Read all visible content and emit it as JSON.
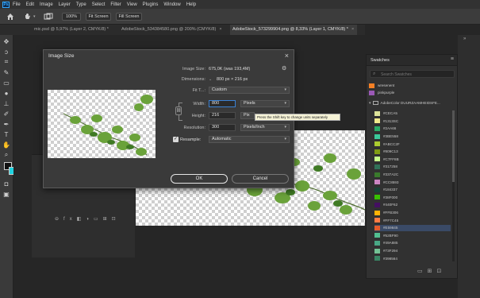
{
  "menubar": {
    "logo": "Ps",
    "items": [
      "File",
      "Edit",
      "Image",
      "Layer",
      "Type",
      "Select",
      "Filter",
      "View",
      "Plugins",
      "Window",
      "Help"
    ]
  },
  "options": {
    "zoom": "100%",
    "fit_screen": "Fit Screen",
    "fill_screen": "Fill Screen"
  },
  "tabs": [
    {
      "label": "mic.psd @ 5,97% (Layer 2, CMYK/8) *",
      "close": "×"
    },
    {
      "label": "AdobeStock_534384580.png @ 200% (CMYK/8)",
      "close": "×"
    },
    {
      "label": "AdobeStock_573299904.png @ 8,33% (Layer 1, CMYK/8) *",
      "close": "×"
    }
  ],
  "dialog": {
    "title": "Image Size",
    "close": "×",
    "image_size_label": "Image Size:",
    "image_size_value": "675,0K (was 193,4M)",
    "gear": "⚙",
    "dimensions_label": "Dimensions:",
    "dimensions_value": "800 px  ×  216 px",
    "fit_to_label": "Fit T...:",
    "fit_to_value": "Custom",
    "width_label": "Width:",
    "width_value": "800",
    "width_unit": "Pixels",
    "height_label": "Height:",
    "height_value": "216",
    "height_unit": "Pix",
    "resolution_label": "Resolution:",
    "resolution_value": "300",
    "resolution_unit": "Pixels/Inch",
    "resample_label": "Resample:",
    "resample_value": "Automatic",
    "tooltip": "Press the Shift key to change units separately",
    "ok": "OK",
    "cancel": "Cancel"
  },
  "swatches": {
    "title": "Swatches",
    "search_placeholder": "Search Swatches",
    "top_items": [
      {
        "name": "wresenent",
        "color": "#f58025"
      },
      {
        "name": "pinkpurple",
        "color": "#9b59b6"
      }
    ],
    "group_name": "AdobeColor DUURZAAMHEIDSFE...",
    "items": [
      {
        "name": "#CECA5",
        "color": "#dde39a"
      },
      {
        "name": "#1313SC",
        "color": "#f0e98c"
      },
      {
        "name": "#2AA66",
        "color": "#2aaa66"
      },
      {
        "name": "#3BE558",
        "color": "#3bc99a"
      },
      {
        "name": "#ABCC2F",
        "color": "#abcc2f"
      },
      {
        "name": "#809C13",
        "color": "#809c13"
      },
      {
        "name": "#C7FF8B",
        "color": "#c7ff8b"
      },
      {
        "name": "#317258",
        "color": "#317258"
      },
      {
        "name": "#337A2C",
        "color": "#3a7a2c"
      },
      {
        "name": "#CC8593",
        "color": "#cc85c3"
      },
      {
        "name": "#184337",
        "color": "#184337"
      },
      {
        "name": "#38F000",
        "color": "#38c000"
      },
      {
        "name": "#440F62",
        "color": "#440f62"
      },
      {
        "name": "#FFB306",
        "color": "#ffb306"
      },
      {
        "name": "#FF7C45",
        "color": "#ff7c45"
      },
      {
        "name": "#E59845",
        "color": "#e55a2b"
      },
      {
        "name": "#52BF90",
        "color": "#52bf90"
      },
      {
        "name": "#49A885",
        "color": "#49a885"
      },
      {
        "name": "#73F294",
        "color": "#73c294"
      },
      {
        "name": "#398564",
        "color": "#398564"
      }
    ]
  },
  "layers_footer": {
    "icons": [
      "link-icon",
      "fx-icon",
      "mask-icon",
      "adjustment-icon",
      "folder-icon",
      "new-layer-icon",
      "trash-icon"
    ]
  }
}
